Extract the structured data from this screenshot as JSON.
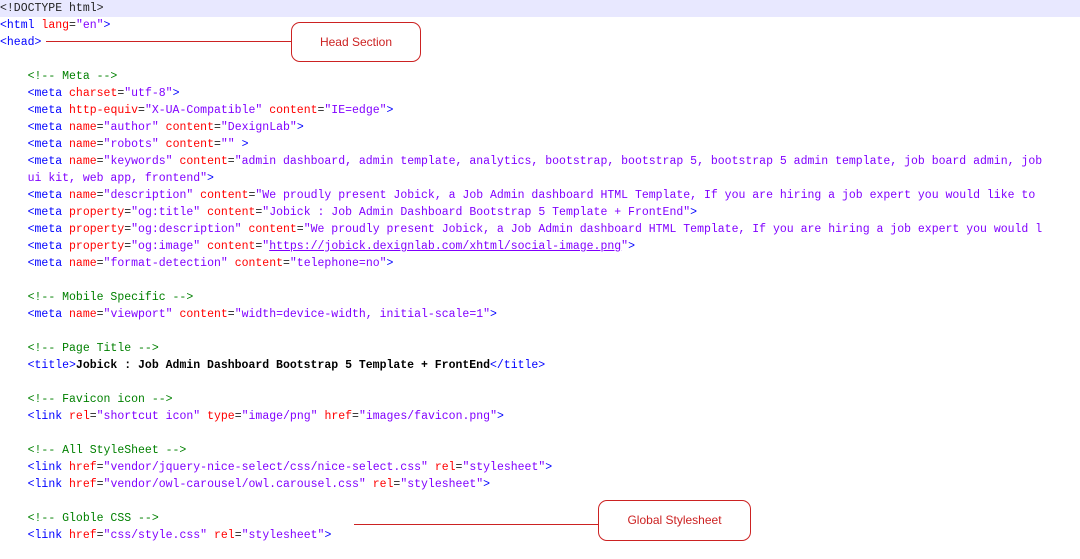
{
  "callouts": {
    "head": "Head Section",
    "global": "Global Stylesheet"
  },
  "code": [
    [
      {
        "t": "<!DOCTYPE html>",
        "c": "plain"
      }
    ],
    [
      {
        "t": "<html ",
        "c": "tag"
      },
      {
        "t": "lang",
        "c": "attr"
      },
      {
        "t": "=",
        "c": "plain"
      },
      {
        "t": "\"en\"",
        "c": "val"
      },
      {
        "t": ">",
        "c": "tag"
      }
    ],
    [
      {
        "t": "<head>",
        "c": "tag"
      }
    ],
    [],
    [
      {
        "t": "    ",
        "c": "plain"
      },
      {
        "t": "<!-- Meta -->",
        "c": "cmt"
      }
    ],
    [
      {
        "t": "    ",
        "c": "plain"
      },
      {
        "t": "<meta ",
        "c": "tag"
      },
      {
        "t": "charset",
        "c": "attr"
      },
      {
        "t": "=",
        "c": "plain"
      },
      {
        "t": "\"utf-8\"",
        "c": "val"
      },
      {
        "t": ">",
        "c": "tag"
      }
    ],
    [
      {
        "t": "    ",
        "c": "plain"
      },
      {
        "t": "<meta ",
        "c": "tag"
      },
      {
        "t": "http-equiv",
        "c": "attr"
      },
      {
        "t": "=",
        "c": "plain"
      },
      {
        "t": "\"X-UA-Compatible\"",
        "c": "val"
      },
      {
        "t": " ",
        "c": "plain"
      },
      {
        "t": "content",
        "c": "attr"
      },
      {
        "t": "=",
        "c": "plain"
      },
      {
        "t": "\"IE=edge\"",
        "c": "val"
      },
      {
        "t": ">",
        "c": "tag"
      }
    ],
    [
      {
        "t": "    ",
        "c": "plain"
      },
      {
        "t": "<meta ",
        "c": "tag"
      },
      {
        "t": "name",
        "c": "attr"
      },
      {
        "t": "=",
        "c": "plain"
      },
      {
        "t": "\"author\"",
        "c": "val"
      },
      {
        "t": " ",
        "c": "plain"
      },
      {
        "t": "content",
        "c": "attr"
      },
      {
        "t": "=",
        "c": "plain"
      },
      {
        "t": "\"DexignLab\"",
        "c": "val"
      },
      {
        "t": ">",
        "c": "tag"
      }
    ],
    [
      {
        "t": "    ",
        "c": "plain"
      },
      {
        "t": "<meta ",
        "c": "tag"
      },
      {
        "t": "name",
        "c": "attr"
      },
      {
        "t": "=",
        "c": "plain"
      },
      {
        "t": "\"robots\"",
        "c": "val"
      },
      {
        "t": " ",
        "c": "plain"
      },
      {
        "t": "content",
        "c": "attr"
      },
      {
        "t": "=",
        "c": "plain"
      },
      {
        "t": "\"\"",
        "c": "val"
      },
      {
        "t": " >",
        "c": "tag"
      }
    ],
    [
      {
        "t": "    ",
        "c": "plain"
      },
      {
        "t": "<meta ",
        "c": "tag"
      },
      {
        "t": "name",
        "c": "attr"
      },
      {
        "t": "=",
        "c": "plain"
      },
      {
        "t": "\"keywords\"",
        "c": "val"
      },
      {
        "t": " ",
        "c": "plain"
      },
      {
        "t": "content",
        "c": "attr"
      },
      {
        "t": "=",
        "c": "plain"
      },
      {
        "t": "\"admin dashboard, admin template, analytics, bootstrap, bootstrap 5, bootstrap 5 admin template, job board admin, job",
        "c": "val"
      }
    ],
    [
      {
        "t": "    ",
        "c": "plain"
      },
      {
        "t": "ui kit, web app, frontend\"",
        "c": "val"
      },
      {
        "t": ">",
        "c": "tag"
      }
    ],
    [
      {
        "t": "    ",
        "c": "plain"
      },
      {
        "t": "<meta ",
        "c": "tag"
      },
      {
        "t": "name",
        "c": "attr"
      },
      {
        "t": "=",
        "c": "plain"
      },
      {
        "t": "\"description\"",
        "c": "val"
      },
      {
        "t": " ",
        "c": "plain"
      },
      {
        "t": "content",
        "c": "attr"
      },
      {
        "t": "=",
        "c": "plain"
      },
      {
        "t": "\"We proudly present Jobick, a Job Admin dashboard HTML Template, If you are hiring a job expert you would like to",
        "c": "val"
      }
    ],
    [
      {
        "t": "    ",
        "c": "plain"
      },
      {
        "t": "<meta ",
        "c": "tag"
      },
      {
        "t": "property",
        "c": "attr"
      },
      {
        "t": "=",
        "c": "plain"
      },
      {
        "t": "\"og:title\"",
        "c": "val"
      },
      {
        "t": " ",
        "c": "plain"
      },
      {
        "t": "content",
        "c": "attr"
      },
      {
        "t": "=",
        "c": "plain"
      },
      {
        "t": "\"Jobick : Job Admin Dashboard Bootstrap 5 Template + FrontEnd\"",
        "c": "val"
      },
      {
        "t": ">",
        "c": "tag"
      }
    ],
    [
      {
        "t": "    ",
        "c": "plain"
      },
      {
        "t": "<meta ",
        "c": "tag"
      },
      {
        "t": "property",
        "c": "attr"
      },
      {
        "t": "=",
        "c": "plain"
      },
      {
        "t": "\"og:description\"",
        "c": "val"
      },
      {
        "t": " ",
        "c": "plain"
      },
      {
        "t": "content",
        "c": "attr"
      },
      {
        "t": "=",
        "c": "plain"
      },
      {
        "t": "\"We proudly present Jobick, a Job Admin dashboard HTML Template, If you are hiring a job expert you would l",
        "c": "val"
      }
    ],
    [
      {
        "t": "    ",
        "c": "plain"
      },
      {
        "t": "<meta ",
        "c": "tag"
      },
      {
        "t": "property",
        "c": "attr"
      },
      {
        "t": "=",
        "c": "plain"
      },
      {
        "t": "\"og:image\"",
        "c": "val"
      },
      {
        "t": " ",
        "c": "plain"
      },
      {
        "t": "content",
        "c": "attr"
      },
      {
        "t": "=",
        "c": "plain"
      },
      {
        "t": "\"",
        "c": "val"
      },
      {
        "t": "https://jobick.dexignlab.com/xhtml/social-image.png",
        "c": "url"
      },
      {
        "t": "\"",
        "c": "val"
      },
      {
        "t": ">",
        "c": "tag"
      }
    ],
    [
      {
        "t": "    ",
        "c": "plain"
      },
      {
        "t": "<meta ",
        "c": "tag"
      },
      {
        "t": "name",
        "c": "attr"
      },
      {
        "t": "=",
        "c": "plain"
      },
      {
        "t": "\"format-detection\"",
        "c": "val"
      },
      {
        "t": " ",
        "c": "plain"
      },
      {
        "t": "content",
        "c": "attr"
      },
      {
        "t": "=",
        "c": "plain"
      },
      {
        "t": "\"telephone=no\"",
        "c": "val"
      },
      {
        "t": ">",
        "c": "tag"
      }
    ],
    [],
    [
      {
        "t": "    ",
        "c": "plain"
      },
      {
        "t": "<!-- Mobile Specific -->",
        "c": "cmt"
      }
    ],
    [
      {
        "t": "    ",
        "c": "plain"
      },
      {
        "t": "<meta ",
        "c": "tag"
      },
      {
        "t": "name",
        "c": "attr"
      },
      {
        "t": "=",
        "c": "plain"
      },
      {
        "t": "\"viewport\"",
        "c": "val"
      },
      {
        "t": " ",
        "c": "plain"
      },
      {
        "t": "content",
        "c": "attr"
      },
      {
        "t": "=",
        "c": "plain"
      },
      {
        "t": "\"width=device-width, initial-scale=1\"",
        "c": "val"
      },
      {
        "t": ">",
        "c": "tag"
      }
    ],
    [],
    [
      {
        "t": "    ",
        "c": "plain"
      },
      {
        "t": "<!-- Page Title -->",
        "c": "cmt"
      }
    ],
    [
      {
        "t": "    ",
        "c": "plain"
      },
      {
        "t": "<title>",
        "c": "tag"
      },
      {
        "t": "Jobick : Job Admin Dashboard Bootstrap 5 Template + FrontEnd",
        "c": "txt"
      },
      {
        "t": "</title>",
        "c": "tag"
      }
    ],
    [],
    [
      {
        "t": "    ",
        "c": "plain"
      },
      {
        "t": "<!-- Favicon icon -->",
        "c": "cmt"
      }
    ],
    [
      {
        "t": "    ",
        "c": "plain"
      },
      {
        "t": "<link ",
        "c": "tag"
      },
      {
        "t": "rel",
        "c": "attr"
      },
      {
        "t": "=",
        "c": "plain"
      },
      {
        "t": "\"shortcut icon\"",
        "c": "val"
      },
      {
        "t": " ",
        "c": "plain"
      },
      {
        "t": "type",
        "c": "attr"
      },
      {
        "t": "=",
        "c": "plain"
      },
      {
        "t": "\"image/png\"",
        "c": "val"
      },
      {
        "t": " ",
        "c": "plain"
      },
      {
        "t": "href",
        "c": "attr"
      },
      {
        "t": "=",
        "c": "plain"
      },
      {
        "t": "\"images/favicon.png\"",
        "c": "val"
      },
      {
        "t": ">",
        "c": "tag"
      }
    ],
    [],
    [
      {
        "t": "    ",
        "c": "plain"
      },
      {
        "t": "<!-- All StyleSheet -->",
        "c": "cmt"
      }
    ],
    [
      {
        "t": "    ",
        "c": "plain"
      },
      {
        "t": "<link ",
        "c": "tag"
      },
      {
        "t": "href",
        "c": "attr"
      },
      {
        "t": "=",
        "c": "plain"
      },
      {
        "t": "\"vendor/jquery-nice-select/css/nice-select.css\"",
        "c": "val"
      },
      {
        "t": " ",
        "c": "plain"
      },
      {
        "t": "rel",
        "c": "attr"
      },
      {
        "t": "=",
        "c": "plain"
      },
      {
        "t": "\"stylesheet\"",
        "c": "val"
      },
      {
        "t": ">",
        "c": "tag"
      }
    ],
    [
      {
        "t": "    ",
        "c": "plain"
      },
      {
        "t": "<link ",
        "c": "tag"
      },
      {
        "t": "href",
        "c": "attr"
      },
      {
        "t": "=",
        "c": "plain"
      },
      {
        "t": "\"vendor/owl-carousel/owl.carousel.css\"",
        "c": "val"
      },
      {
        "t": " ",
        "c": "plain"
      },
      {
        "t": "rel",
        "c": "attr"
      },
      {
        "t": "=",
        "c": "plain"
      },
      {
        "t": "\"stylesheet\"",
        "c": "val"
      },
      {
        "t": ">",
        "c": "tag"
      }
    ],
    [],
    [
      {
        "t": "    ",
        "c": "plain"
      },
      {
        "t": "<!-- Globle CSS -->",
        "c": "cmt"
      }
    ],
    [
      {
        "t": "    ",
        "c": "plain"
      },
      {
        "t": "<link ",
        "c": "tag"
      },
      {
        "t": "href",
        "c": "attr"
      },
      {
        "t": "=",
        "c": "plain"
      },
      {
        "t": "\"css/style.css\"",
        "c": "val"
      },
      {
        "t": " ",
        "c": "plain"
      },
      {
        "t": "rel",
        "c": "attr"
      },
      {
        "t": "=",
        "c": "plain"
      },
      {
        "t": "\"stylesheet\"",
        "c": "val"
      },
      {
        "t": ">",
        "c": "tag"
      }
    ]
  ]
}
